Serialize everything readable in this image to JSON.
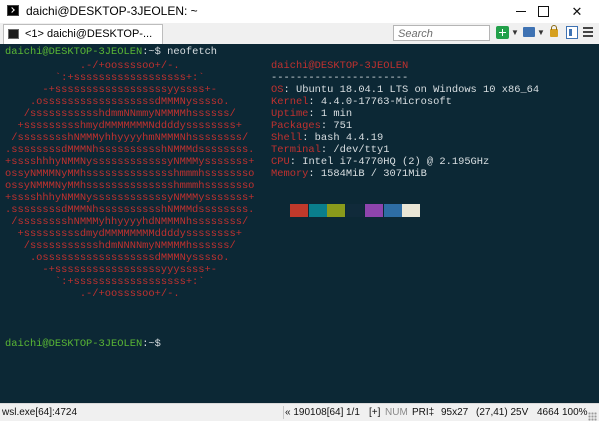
{
  "window": {
    "title": "daichi@DESKTOP-3JEOLEN: ~",
    "controls": {
      "minimize": "minimize",
      "maximize": "maximize",
      "close": "✕"
    }
  },
  "tabbar": {
    "tab_label": "<1> daichi@DESKTOP-...",
    "search_placeholder": "Search"
  },
  "console": {
    "prompt_user": "daichi@DESKTOP-3JEOLEN",
    "prompt_suffix": ":~$",
    "command": "neofetch",
    "logo_lines": [
      "            .-/+oossssoo+/-.",
      "        `:+ssssssssssssssssss+:`",
      "      -+ssssssssssssssssssyyssss+-",
      "    .ossssssssssssssssssdMMMNysssso.",
      "   /ssssssssssshdmmNNmmyNMMMMhssssss/",
      "  +ssssssssshmydMMMMMMMNddddyssssssss+",
      " /sssssssshNMMMyhhyyyyhmNMMMNhssssssss/",
      ".ssssssssdMMMNhsssssssssshNMMMdssssssss.",
      "+sssshhhyNMMNyssssssssssssyNMMMysssssss+",
      "ossyNMMMNyMMhsssssssssssssshmmmhssssssso",
      "ossyNMMMNyMMhsssssssssssssshmmmhssssssso",
      "+sssshhhyNMMNyssssssssssssyNMMMysssssss+",
      ".ssssssssdMMMNhsssssssssshNMMMdssssssss.",
      " /sssssssshNMMMyhhyyyyhdNMMMNhssssssss/",
      "  +sssssssssdmydMMMMMMMMddddyssssssss+",
      "   /ssssssssssshdmNNNNmyNMMMMhssssss/",
      "    .ossssssssssssssssssdMMMNysssso.",
      "      -+sssssssssssssssssyyyssss+-",
      "        `:+ssssssssssssssssss+:`",
      "            .-/+oossssoo+/-."
    ],
    "info_header": "daichi@DESKTOP-3JEOLEN",
    "info_separator": "----------------------",
    "info": [
      {
        "key": "OS",
        "value": "Ubuntu 18.04.1 LTS on Windows 10 x86_64"
      },
      {
        "key": "Kernel",
        "value": "4.4.0-17763-Microsoft"
      },
      {
        "key": "Uptime",
        "value": "1 min"
      },
      {
        "key": "Packages",
        "value": "751"
      },
      {
        "key": "Shell",
        "value": "bash 4.4.19"
      },
      {
        "key": "Terminal",
        "value": "/dev/tty1"
      },
      {
        "key": "CPU",
        "value": "Intel i7-4770HQ (2) @ 2.195GHz"
      },
      {
        "key": "Memory",
        "value": "1584MiB / 3071MiB"
      }
    ],
    "palette": [
      "#c0392b",
      "#0a7e8c",
      "#8a9a1b",
      "#102a3a",
      "#8e44ad",
      "#2e6da4",
      "#e9e6d6"
    ],
    "prompt2_user": "daichi@DESKTOP-3JEOLEN",
    "prompt2_suffix": ":~$"
  },
  "statusbar": {
    "process": "wsl.exe[64]:4724",
    "scroll_info": "« 190108[64]",
    "page": "1/1",
    "ins": "[+]",
    "num": "NUM",
    "pri": "PRI‡",
    "size": "95x27",
    "cursor": "(27,41) 25V",
    "pid": "4664",
    "zoom": "100%"
  },
  "colors": {
    "console_bg": "#0c2835",
    "logo_red": "#c1312f",
    "prompt_green": "#5ab735",
    "text": "#d9dfe2"
  }
}
